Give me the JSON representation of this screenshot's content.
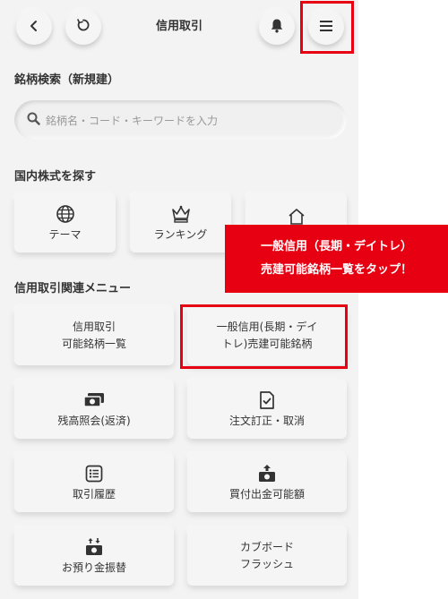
{
  "header": {
    "title": "信用取引",
    "back_icon": "chevron-left-icon",
    "refresh_icon": "refresh-icon",
    "bell_icon": "bell-icon",
    "menu_icon": "hamburger-icon"
  },
  "search": {
    "section_title": "銘柄検索（新規建）",
    "placeholder": "銘柄名・コード・キーワードを入力"
  },
  "domestic": {
    "section_title": "国内株式を探す",
    "items": [
      {
        "label": "テーマ",
        "icon": "globe-icon"
      },
      {
        "label": "ランキング",
        "icon": "crown-icon"
      },
      {
        "label": "",
        "icon": "home-icon"
      }
    ]
  },
  "menu": {
    "section_title": "信用取引関連メニュー",
    "items": [
      {
        "line1": "信用取引",
        "line2": "可能銘柄一覧",
        "icon": ""
      },
      {
        "line1": "一般信用(長期・デイ",
        "line2": "トレ)売建可能銘柄",
        "icon": ""
      },
      {
        "line1": "残高照会(返済)",
        "line2": "",
        "icon": "cash-icon"
      },
      {
        "line1": "注文訂正・取消",
        "line2": "",
        "icon": "document-check-icon"
      },
      {
        "line1": "取引履歴",
        "line2": "",
        "icon": "list-icon"
      },
      {
        "line1": "買付出金可能額",
        "line2": "",
        "icon": "cash-out-icon"
      },
      {
        "line1": "お預り金振替",
        "line2": "",
        "icon": "transfer-icon"
      },
      {
        "line1": "カブボード",
        "line2": "フラッシュ",
        "icon": ""
      }
    ]
  },
  "annotation": {
    "line1": "一般信用（長期・デイトレ）",
    "line2": "売建可能銘柄一覧をタップ！",
    "color": "#e60012"
  }
}
